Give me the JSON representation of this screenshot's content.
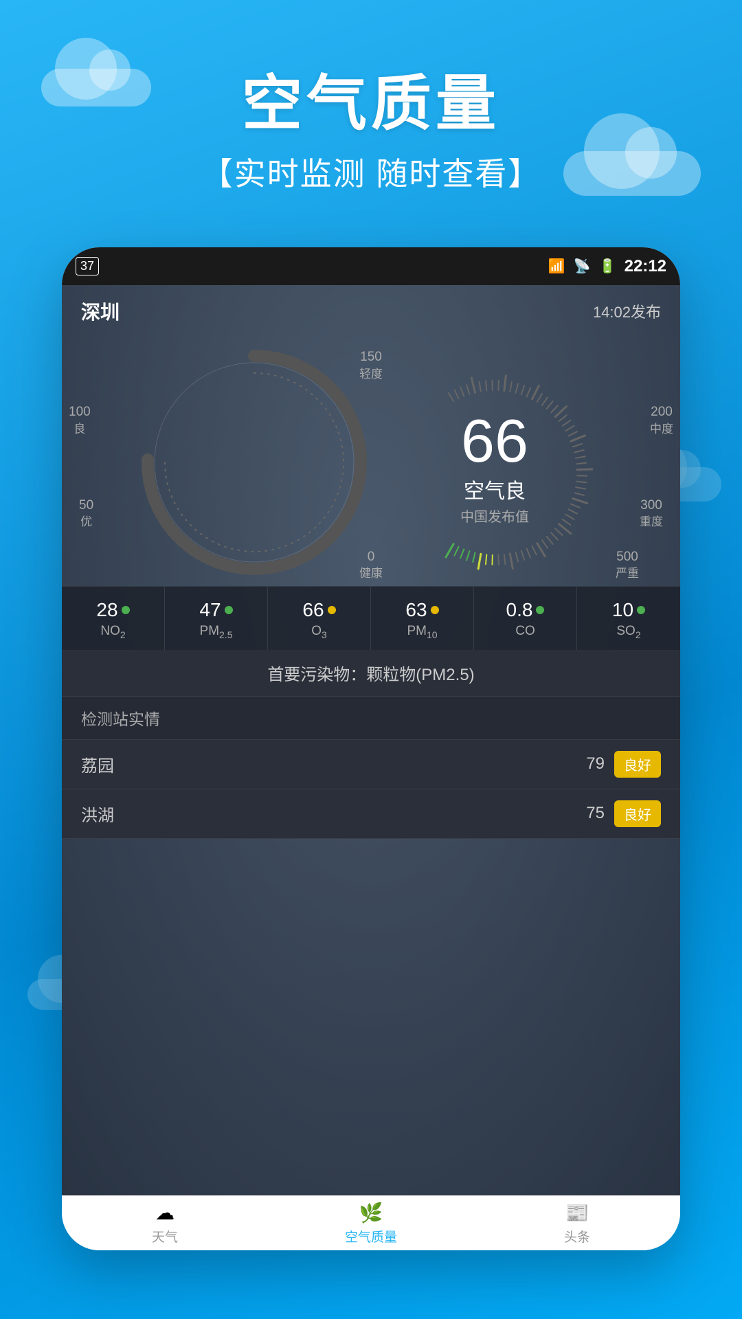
{
  "header": {
    "title": "空气质量",
    "subtitle": "【实时监测 随时查看】"
  },
  "status_bar": {
    "badge": "37",
    "time": "22:12"
  },
  "app": {
    "city": "深圳",
    "published": "14:02发布",
    "gauge": {
      "value": "66",
      "status": "空气良",
      "subtitle": "中国发布值",
      "labels": [
        {
          "text": "0\n健康",
          "pos": "bottom-center"
        },
        {
          "text": "50\n优",
          "pos": "left-low"
        },
        {
          "text": "100\n良",
          "pos": "left-mid"
        },
        {
          "text": "150\n轻度",
          "pos": "top-center"
        },
        {
          "text": "200\n中度",
          "pos": "right-mid"
        },
        {
          "text": "300\n重度",
          "pos": "right-low"
        },
        {
          "text": "500\n严重",
          "pos": "bottom-right"
        }
      ]
    },
    "pollutants": [
      {
        "value": "28",
        "name": "NO₂",
        "dot_color": "#4caf50",
        "subscript": "2"
      },
      {
        "value": "47",
        "name": "PM₂.₅",
        "dot_color": "#4caf50"
      },
      {
        "value": "66",
        "name": "O₃",
        "dot_color": "#e6b800",
        "subscript": "3"
      },
      {
        "value": "63",
        "name": "PM₁₀",
        "dot_color": "#e6b800"
      },
      {
        "value": "0.8",
        "name": "CO",
        "dot_color": "#4caf50"
      },
      {
        "value": "10",
        "name": "SO₂",
        "dot_color": "#4caf50",
        "subscript": "2"
      }
    ],
    "primary_pollutant": "首要污染物：颗粒物(PM2.5)",
    "station_header": "检测站实情",
    "stations": [
      {
        "name": "荔园",
        "score": "79",
        "badge": "良好"
      },
      {
        "name": "洪湖",
        "score": "75",
        "badge": "良好"
      }
    ]
  },
  "tabs": [
    {
      "label": "天气",
      "icon": "☁",
      "active": false
    },
    {
      "label": "空气质量",
      "icon": "🌿",
      "active": true
    },
    {
      "label": "头条",
      "icon": "📰",
      "active": false
    }
  ]
}
